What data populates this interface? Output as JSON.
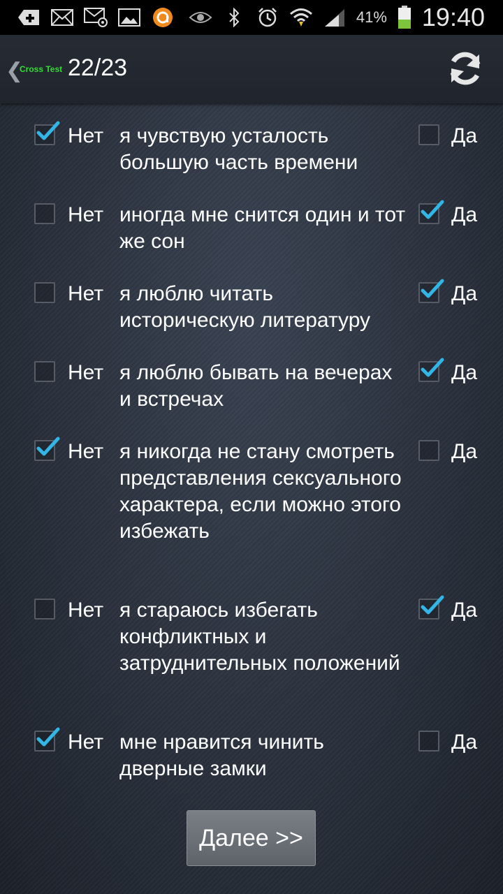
{
  "status": {
    "battery_percent": "41%",
    "time": "19:40",
    "icons": [
      "plus-tag-icon",
      "mail-icon",
      "mail-at-icon",
      "image-icon",
      "orange-app-icon",
      "eye-icon",
      "bluetooth-icon",
      "alarm-icon",
      "wifi-icon",
      "signal-icon",
      "battery-icon"
    ]
  },
  "header": {
    "app_name": "Cross Test",
    "counter": "22/23"
  },
  "labels": {
    "no": "Нет",
    "yes": "Да"
  },
  "questions": [
    {
      "text": "я чувствую усталость большую часть времени",
      "answer": "no"
    },
    {
      "text": "иногда мне снится один и тот же сон",
      "answer": "yes"
    },
    {
      "text": "я люблю читать историческую литературу",
      "answer": "yes"
    },
    {
      "text": "я люблю бывать на вечерах и встречах",
      "answer": "yes"
    },
    {
      "text": "я никогда не стану смотреть представления сексуального характера, если можно этого избежать",
      "answer": "no"
    },
    {
      "text": "я стараюсь избегать конфликтных и затруднительных положений",
      "answer": "yes"
    },
    {
      "text": "мне нравится чинить дверные замки",
      "answer": "no"
    }
  ],
  "next_button": "Далее >>",
  "colors": {
    "accent_check": "#33b5e5",
    "app_name": "#33dd33"
  }
}
